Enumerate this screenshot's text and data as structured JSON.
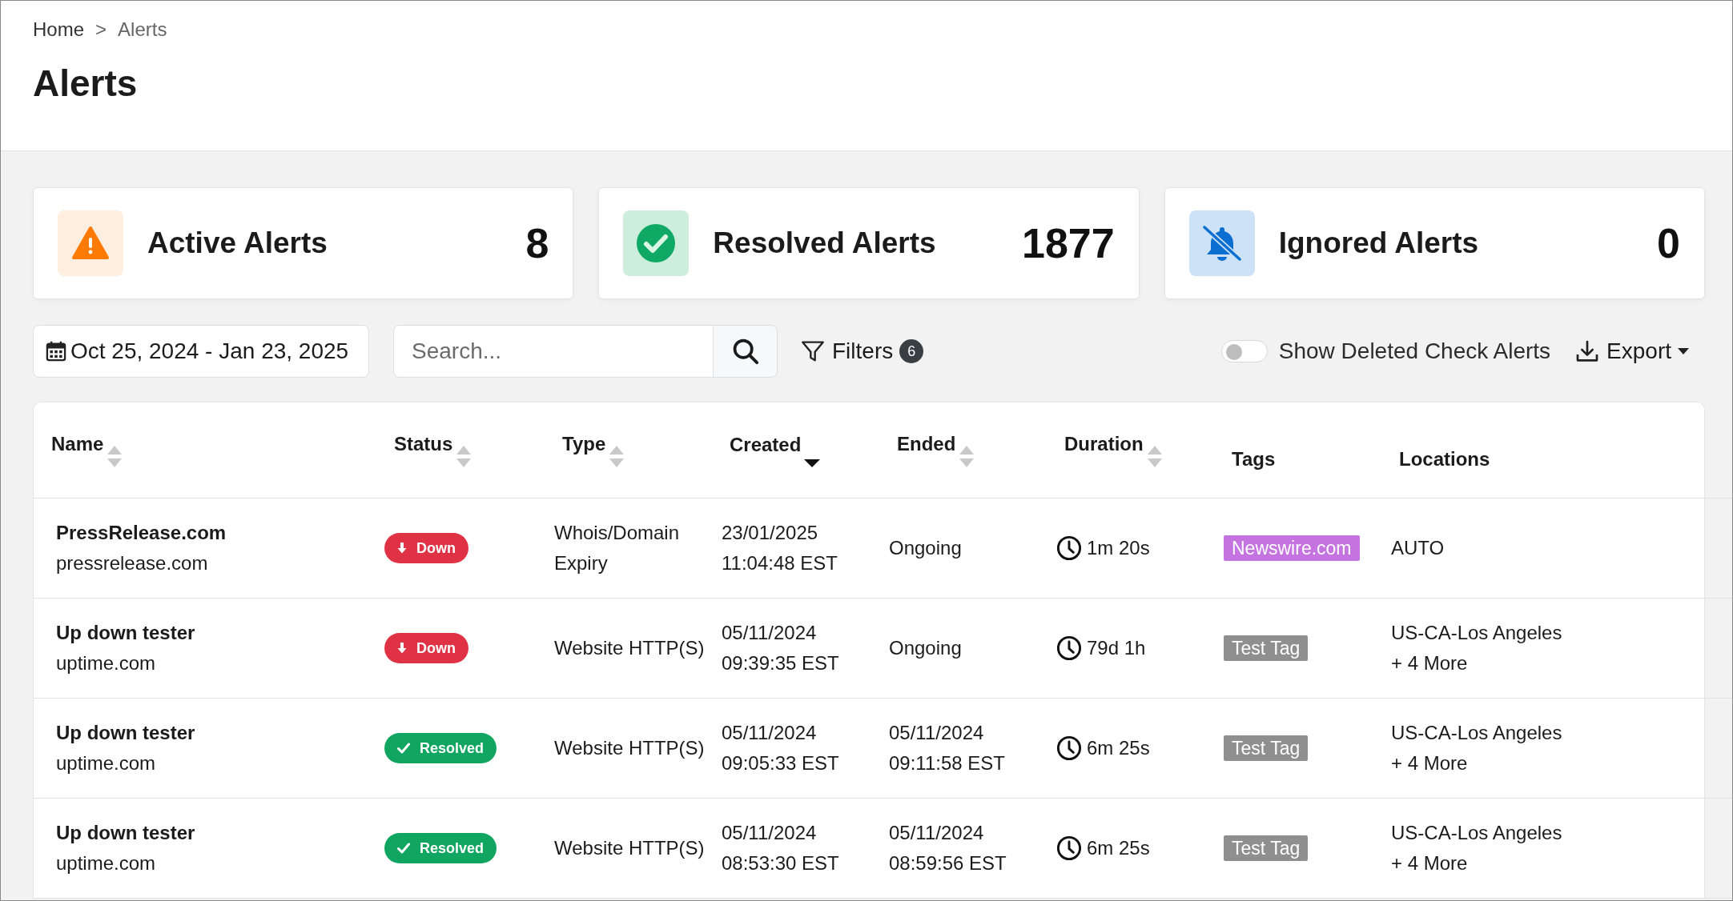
{
  "breadcrumb": {
    "items": [
      {
        "label": "Home",
        "selected": false
      },
      {
        "label": "Alerts",
        "selected": true
      }
    ],
    "separator": ">"
  },
  "title": "Alerts",
  "stats": [
    {
      "kind": "active",
      "label": "Active Alerts",
      "count": "8"
    },
    {
      "kind": "resolved",
      "label": "Resolved Alerts",
      "count": "1877"
    },
    {
      "kind": "ignored",
      "label": "Ignored Alerts",
      "count": "0"
    }
  ],
  "toolbar": {
    "date_range": "Oct 25, 2024 - Jan 23, 2025",
    "search": {
      "placeholder": "Search..."
    },
    "filters": {
      "label": "Filters",
      "count": "6"
    },
    "toggle": {
      "label": "Show Deleted Check Alerts",
      "on": false
    },
    "export": "Export"
  },
  "table": {
    "columns": [
      {
        "label": "Name",
        "sortable": true,
        "sorted": false
      },
      {
        "label": "Status",
        "sortable": true,
        "sorted": false
      },
      {
        "label": "Type",
        "sortable": true,
        "sorted": false
      },
      {
        "label": "Created",
        "sortable": true,
        "sorted": true
      },
      {
        "label": "Ended",
        "sortable": true,
        "sorted": false
      },
      {
        "label": "Duration",
        "sortable": true,
        "sorted": false
      },
      {
        "label": "Tags",
        "sortable": false
      },
      {
        "label": "Locations",
        "sortable": false
      }
    ],
    "rows": [
      {
        "name": "PressRelease.com",
        "host": "pressrelease.com",
        "status": {
          "kind": "down",
          "label": "Down"
        },
        "type": "Whois/Domain Expiry",
        "created": [
          "23/01/2025",
          "11:04:48 EST"
        ],
        "ended": [
          "Ongoing"
        ],
        "duration": "1m 20s",
        "tag": {
          "label": "Newswire.com",
          "color": "#c473e0"
        },
        "locations": [
          "AUTO"
        ]
      },
      {
        "name": "Up down tester",
        "host": "uptime.com",
        "status": {
          "kind": "down",
          "label": "Down"
        },
        "type": "Website HTTP(S)",
        "created": [
          "05/11/2024",
          "09:39:35 EST"
        ],
        "ended": [
          "Ongoing"
        ],
        "duration": "79d 1h",
        "tag": {
          "label": "Test Tag",
          "color": "#8f8f8f"
        },
        "locations": [
          "US-CA-Los Angeles",
          "+ 4 More"
        ]
      },
      {
        "name": "Up down tester",
        "host": "uptime.com",
        "status": {
          "kind": "resolved",
          "label": "Resolved"
        },
        "type": "Website HTTP(S)",
        "created": [
          "05/11/2024",
          "09:05:33 EST"
        ],
        "ended": [
          "05/11/2024",
          "09:11:58 EST"
        ],
        "duration": "6m 25s",
        "tag": {
          "label": "Test Tag",
          "color": "#8f8f8f"
        },
        "locations": [
          "US-CA-Los Angeles",
          "+ 4 More"
        ]
      },
      {
        "name": "Up down tester",
        "host": "uptime.com",
        "status": {
          "kind": "resolved",
          "label": "Resolved"
        },
        "type": "Website HTTP(S)",
        "created": [
          "05/11/2024",
          "08:53:30 EST"
        ],
        "ended": [
          "05/11/2024",
          "08:59:56 EST"
        ],
        "duration": "6m 25s",
        "tag": {
          "label": "Test Tag",
          "color": "#8f8f8f"
        },
        "locations": [
          "US-CA-Los Angeles",
          "+ 4 More"
        ]
      }
    ]
  }
}
